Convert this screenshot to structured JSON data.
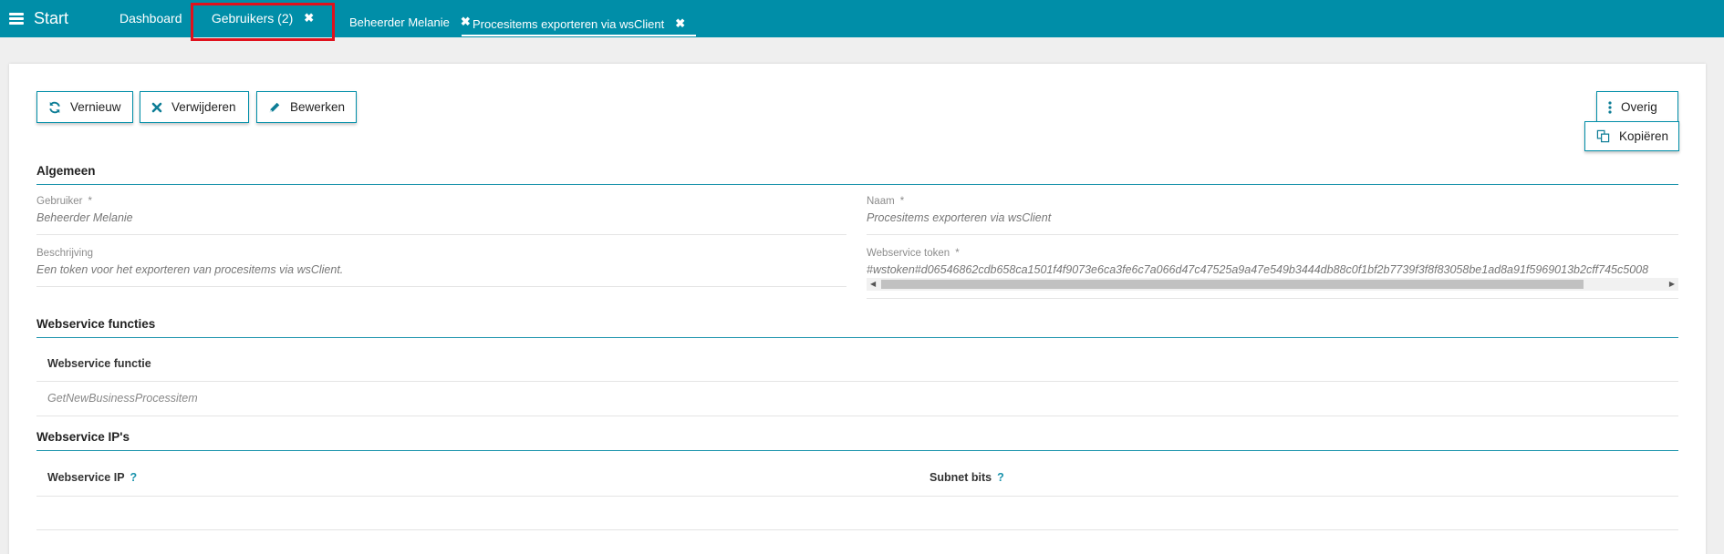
{
  "topbar": {
    "brand_label": "Start",
    "tabs": [
      {
        "label": "Dashboard"
      },
      {
        "label": "Gebruikers (2)",
        "close": "✖"
      },
      {
        "label": "Beheerder Melanie",
        "close": "✖"
      },
      {
        "label": "Procesitems exporteren via wsClient",
        "close": "✖"
      }
    ]
  },
  "toolbar": {
    "refresh_label": "Vernieuw",
    "delete_label": "Verwijderen",
    "edit_label": "Bewerken",
    "more_label": "Overig",
    "copy_label": "Kopiëren"
  },
  "sections": {
    "general": "Algemeen",
    "ws_functions": "Webservice functies",
    "ws_ips": "Webservice IP's"
  },
  "fields": {
    "user": {
      "label": "Gebruiker",
      "required": "*",
      "value": "Beheerder Melanie"
    },
    "name": {
      "label": "Naam",
      "required": "*",
      "value": "Procesitems exporteren via wsClient"
    },
    "description": {
      "label": "Beschrijving",
      "value": "Een token voor het exporteren van procesitems via wsClient."
    },
    "token": {
      "label": "Webservice token",
      "required": "*",
      "value": "#wstoken#d06546862cdb658ca1501f4f9073e6ca3fe6c7a066d47c47525a9a47e549b3444db88c0f1bf2b7739f3f8f83058be1ad8a91f5969013b2cff745c5008"
    }
  },
  "ws_functions_table": {
    "header": "Webservice functie",
    "rows": [
      "GetNewBusinessProcessitem"
    ]
  },
  "ws_ips_table": {
    "headers": [
      "Webservice IP",
      "Subnet bits"
    ],
    "help": "?"
  },
  "colors": {
    "accent": "#008ea8",
    "highlight": "#e0111c"
  }
}
